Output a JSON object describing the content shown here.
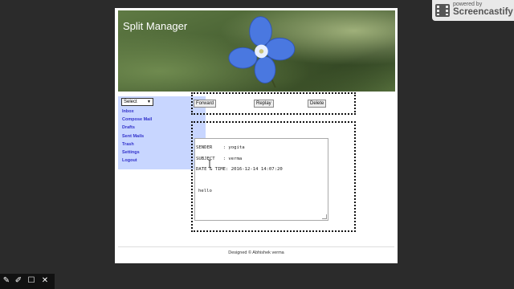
{
  "banner": {
    "title": "Split Manager"
  },
  "sidebar": {
    "select_value": "Select",
    "items": [
      {
        "label": "Inbox"
      },
      {
        "label": "Compose Mail"
      },
      {
        "label": "Drafts"
      },
      {
        "label": "Sent Mails"
      },
      {
        "label": "Trash"
      },
      {
        "label": "Settings"
      },
      {
        "label": "Logout"
      }
    ]
  },
  "actions": {
    "forward": "Forward",
    "replay": "Replay",
    "delete": "Delete"
  },
  "message": {
    "sender": "SENDER    : yogita",
    "subject": "SUBJECT   : verma",
    "datetime": "DATE & TIME: 2016-12-14 14:07:20",
    "body": "hello"
  },
  "footer": {
    "text": "Designed © Abhishek verma"
  },
  "recorder": {
    "small": "powered by",
    "brand": "Screencastify"
  }
}
